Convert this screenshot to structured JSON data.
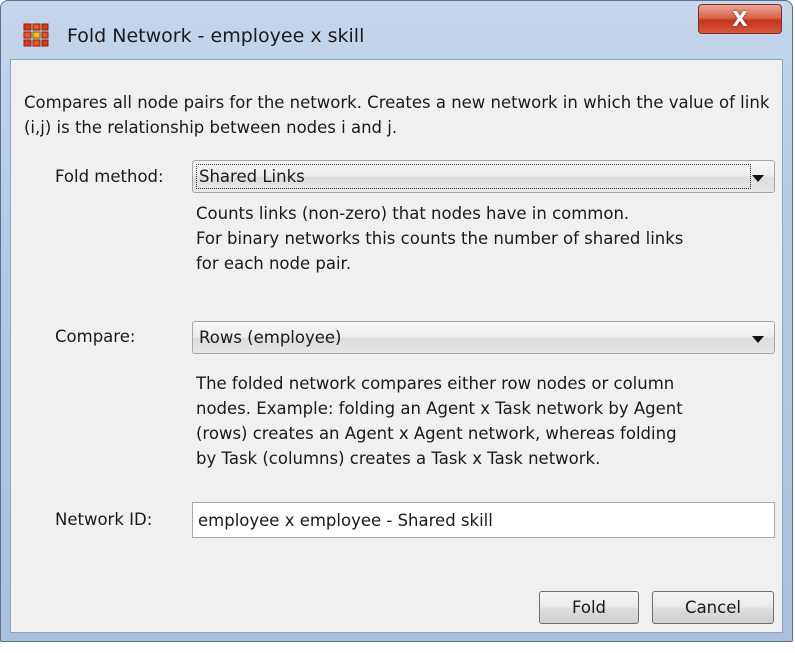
{
  "window": {
    "title": "Fold Network - employee x skill",
    "close_label": "X"
  },
  "description": "Compares all node pairs for the network. Creates a new network in which the value of link (i,j) is the relationship between nodes i and j.",
  "fold_method": {
    "label": "Fold method:",
    "value": "Shared Links",
    "help_lines": [
      "Counts links (non-zero) that nodes have in common.",
      "For binary networks this counts the number of shared links",
      "for each node pair."
    ]
  },
  "compare": {
    "label": "Compare:",
    "value": "Rows (employee)",
    "help_lines": [
      "The folded network compares either row nodes or column",
      "nodes. Example: folding an Agent x Task network by Agent",
      "(rows) creates an Agent x Agent network, whereas folding",
      "by Task (columns) creates a Task x Task network."
    ]
  },
  "network_id": {
    "label": "Network ID:",
    "value": "employee x employee - Shared skill"
  },
  "buttons": {
    "fold_label": "Fold",
    "cancel_label": "Cancel"
  },
  "colors": {
    "title_bar": "#b4c9e4",
    "close_button": "#c6341c",
    "client_bg": "#f0f0f0",
    "icon": "#d23a1a"
  },
  "icons": {
    "app": "network-grid-icon",
    "dropdown": "chevron-down-icon"
  }
}
